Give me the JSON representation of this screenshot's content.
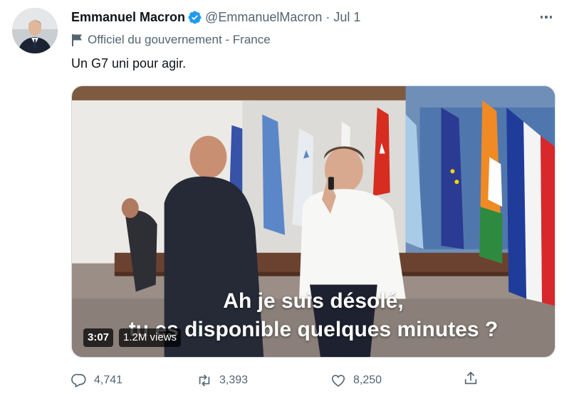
{
  "author": {
    "name": "Emmanuel Macron",
    "handle": "@EmmanuelMacron",
    "date": "Jul 1",
    "separator": "·"
  },
  "account_label": "Officiel du gouvernement - France",
  "tweet_text": "Un G7 uni pour agir.",
  "media": {
    "caption_line1": "Ah je suis désolé,",
    "caption_line2": "tu es disponible quelques minutes ?",
    "duration": "3:07",
    "views": "1.2M views"
  },
  "actions": {
    "replies": "4,741",
    "retweets": "3,393",
    "likes": "8,250"
  },
  "colors": {
    "verified": "#1d9bf0",
    "secondary_text": "#536471",
    "primary_text": "#0f1419"
  },
  "icons": [
    "verified-badge-icon",
    "government-flag-icon",
    "more-icon",
    "play-video",
    "reply-icon",
    "retweet-icon",
    "like-icon",
    "share-icon"
  ]
}
